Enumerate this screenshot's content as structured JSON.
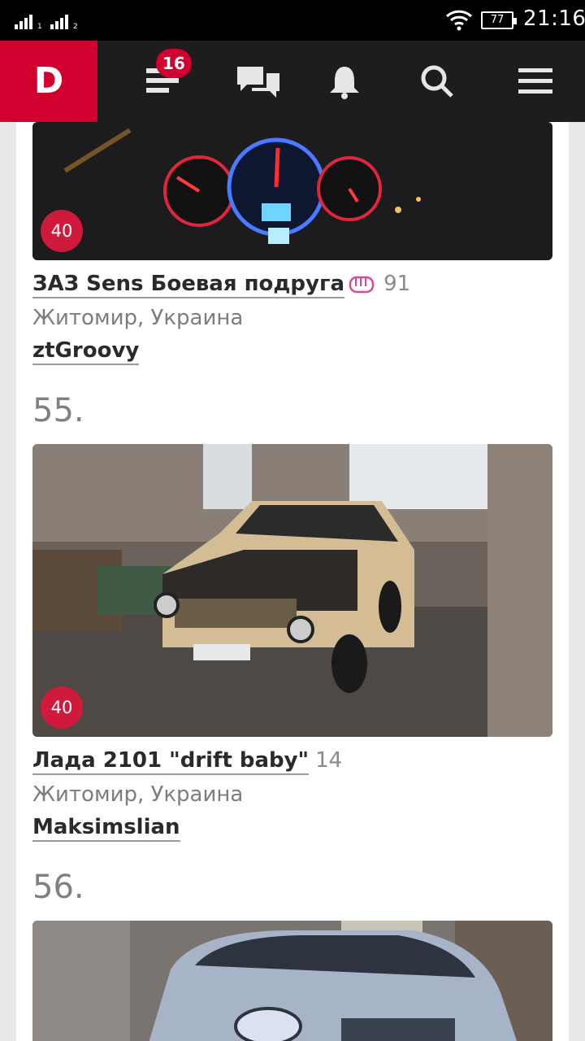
{
  "status_bar": {
    "sim1_label": "1",
    "sim2_label": "2",
    "battery_level": "77",
    "time": "21:16"
  },
  "app_bar": {
    "logo": "D",
    "feed_badge": "16",
    "icons": [
      "feed-icon",
      "messages-icon",
      "bell-icon",
      "search-icon",
      "menu-icon"
    ]
  },
  "entries": [
    {
      "badge": "40",
      "title": "ЗАЗ Sens Боевая подруга",
      "count": "91",
      "location": "Житомир, Украина",
      "user": "ztGroovy"
    },
    {
      "rank": "55.",
      "badge": "40",
      "title": "Лада 2101 \"drift baby\"",
      "count": "14",
      "location": "Житомир, Украина",
      "user": "Maksimslian"
    },
    {
      "rank": "56."
    }
  ],
  "colors": {
    "brand": "#d2002e",
    "badge": "#cf1a3c",
    "appbar": "#1d1d1d"
  }
}
